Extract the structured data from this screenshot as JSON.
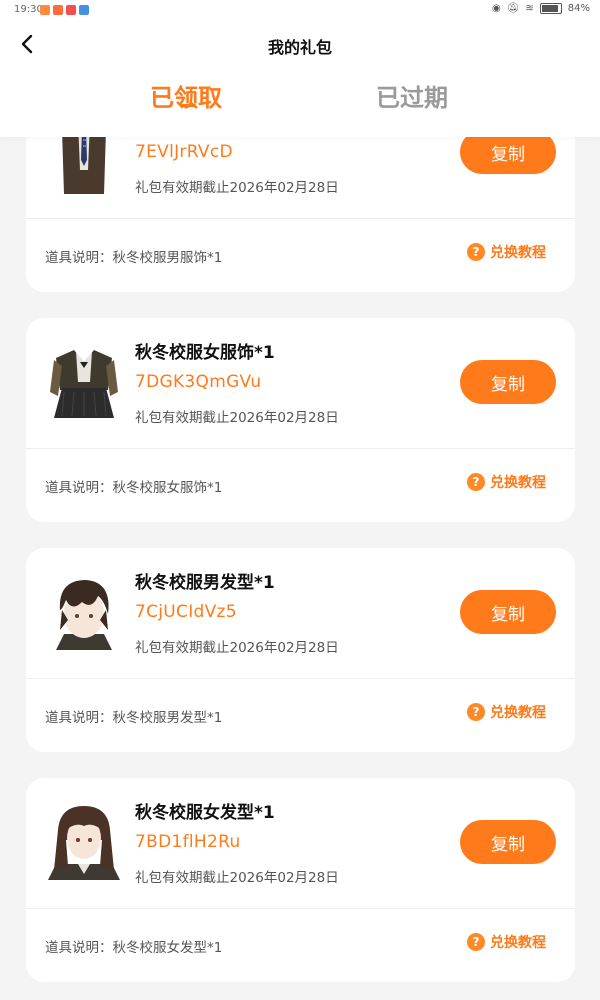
{
  "status_bar": {
    "time": "19:30",
    "battery": "84%"
  },
  "header": {
    "title": "我的礼包"
  },
  "tabs": [
    {
      "label": "已领取"
    },
    {
      "label": "已过期"
    }
  ],
  "colors": {
    "accent": "#ff7a1a",
    "inactive_tab": "#9a9a9a",
    "page_bg": "#f4f4f4"
  },
  "cards": [
    {
      "name": "",
      "code": "7EVlJrRVcD",
      "validity": "礼包有效期截止2026年02月28日",
      "copy_label": "复制",
      "desc": "道具说明：秋冬校服男服饰*1",
      "tutorial_label": "兑换教程"
    },
    {
      "name": "秋冬校服女服饰*1",
      "code": "7DGK3QmGVu",
      "validity": "礼包有效期截止2026年02月28日",
      "copy_label": "复制",
      "desc": "道具说明：秋冬校服女服饰*1",
      "tutorial_label": "兑换教程"
    },
    {
      "name": "秋冬校服男发型*1",
      "code": "7CjUCIdVz5",
      "validity": "礼包有效期截止2026年02月28日",
      "copy_label": "复制",
      "desc": "道具说明：秋冬校服男发型*1",
      "tutorial_label": "兑换教程"
    },
    {
      "name": "秋冬校服女发型*1",
      "code": "7BD1flH2Ru",
      "validity": "礼包有效期截止2026年02月28日",
      "copy_label": "复制",
      "desc": "道具说明：秋冬校服女发型*1",
      "tutorial_label": "兑换教程"
    }
  ]
}
